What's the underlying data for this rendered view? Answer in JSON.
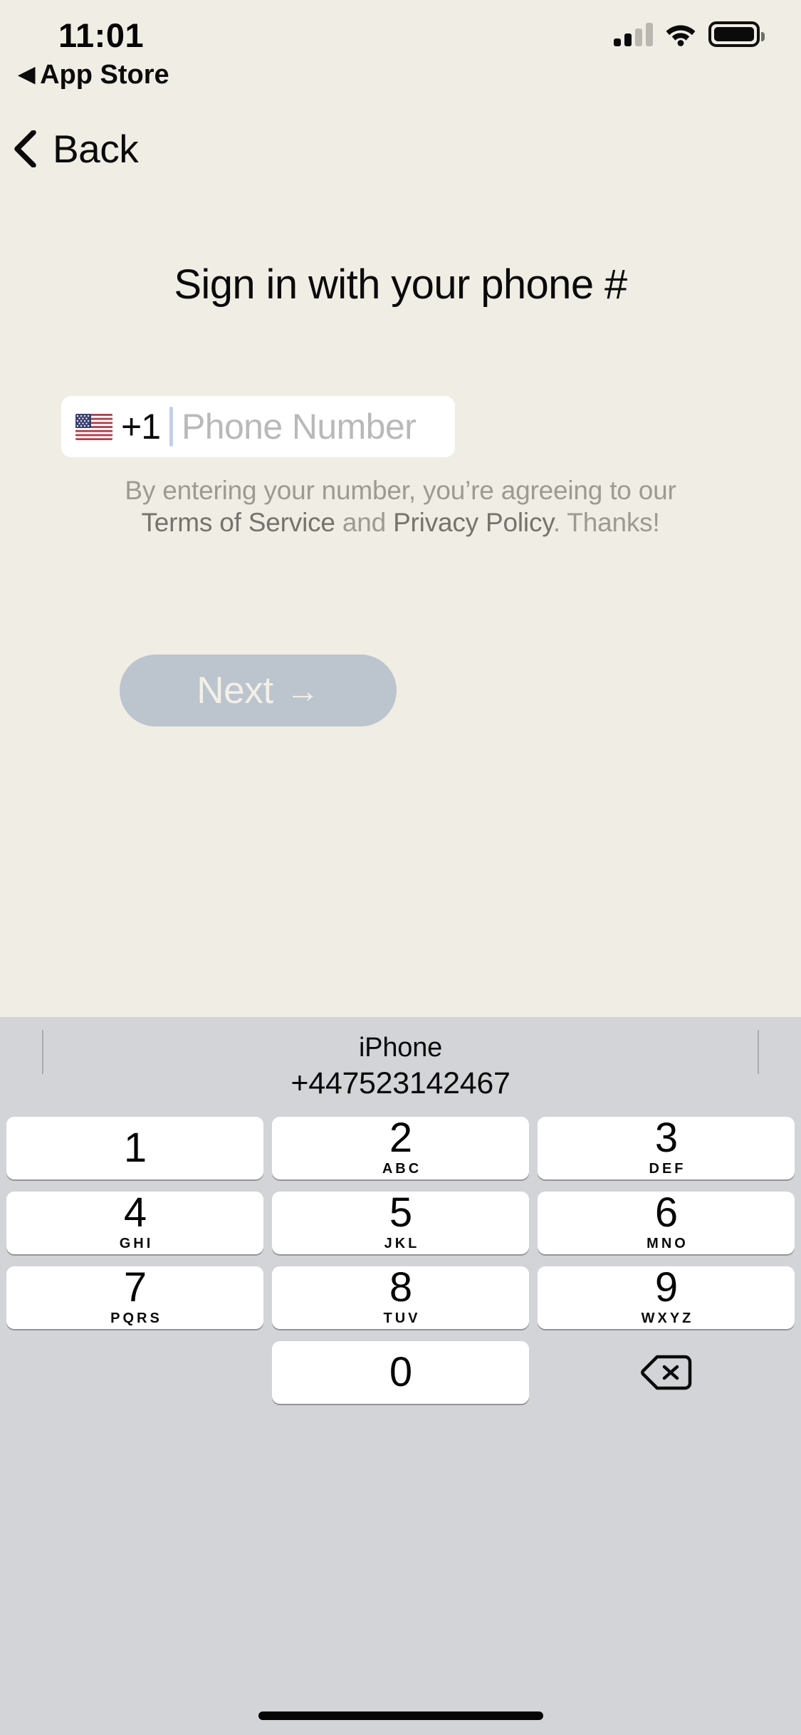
{
  "status_bar": {
    "time": "11:01",
    "return_app": "App Store",
    "return_arrow": "◀",
    "signal_icon": "cellular-signal-icon",
    "signal_bars_filled": 2,
    "signal_bars_total": 4,
    "wifi_icon": "wifi-icon",
    "battery_icon": "battery-icon",
    "battery_level_percent": 88
  },
  "nav": {
    "back_label": "Back",
    "back_icon": "chevron-left-icon"
  },
  "content": {
    "title": "Sign in with your phone #",
    "phone_input": {
      "flag_icon": "us-flag-icon",
      "country_code": "+1",
      "placeholder": "Phone Number",
      "value": ""
    },
    "legal": {
      "line1": "By entering your number, you’re agreeing to our",
      "terms_link": "Terms of Service",
      "and": " and ",
      "privacy_link": "Privacy Policy",
      "tail": ". Thanks!"
    },
    "next_button": {
      "label": "Next",
      "arrow": "→"
    }
  },
  "keyboard": {
    "suggestion": {
      "title": "iPhone",
      "number": "+447523142467"
    },
    "rows": [
      [
        {
          "digit": "1",
          "letters": ""
        },
        {
          "digit": "2",
          "letters": "ABC"
        },
        {
          "digit": "3",
          "letters": "DEF"
        }
      ],
      [
        {
          "digit": "4",
          "letters": "GHI"
        },
        {
          "digit": "5",
          "letters": "JKL"
        },
        {
          "digit": "6",
          "letters": "MNO"
        }
      ],
      [
        {
          "digit": "7",
          "letters": "PQRS"
        },
        {
          "digit": "8",
          "letters": "TUV"
        },
        {
          "digit": "9",
          "letters": "WXYZ"
        }
      ],
      [
        {
          "digit": "",
          "letters": "",
          "type": "blank"
        },
        {
          "digit": "0",
          "letters": ""
        },
        {
          "digit": "",
          "letters": "",
          "type": "delete",
          "icon": "backspace-icon"
        }
      ]
    ],
    "home_indicator": "home-indicator"
  },
  "colors": {
    "background": "#f0ede5",
    "keyboard_background": "#d3d4d8",
    "key_background": "#ffffff",
    "next_button": "#bcc4ce",
    "next_label": "#f3f0e7",
    "placeholder": "#b9b9b9",
    "legal_text": "#9d9a92",
    "caret": "#c3cfe8"
  }
}
